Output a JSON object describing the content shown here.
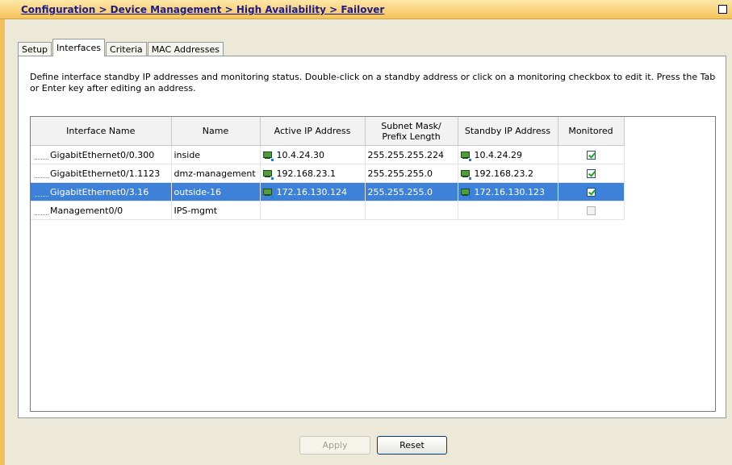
{
  "breadcrumb": {
    "part1": "Configuration > Device Management > High Availability",
    "separator": " > ",
    "part2": "Failover"
  },
  "tabs": [
    {
      "label": "Setup",
      "active": false
    },
    {
      "label": "Interfaces",
      "active": true
    },
    {
      "label": "Criteria",
      "active": false
    },
    {
      "label": "MAC Addresses",
      "active": false
    }
  ],
  "description": "Define interface standby IP addresses and monitoring status. Double-click on a standby address or click on a monitoring checkbox to edit it. Press the Tab or Enter key after editing an address.",
  "table": {
    "headers": {
      "interface_name": "Interface Name",
      "name": "Name",
      "active_ip": "Active IP Address",
      "subnet_line1": "Subnet Mask/",
      "subnet_line2": "Prefix Length",
      "standby_ip": "Standby IP Address",
      "monitored": "Monitored"
    },
    "rows": [
      {
        "interface": "GigabitEthernet0/0.300",
        "name": "inside",
        "active_ip": "10.4.24.30",
        "subnet": "255.255.255.224",
        "standby_ip": "10.4.24.29",
        "monitored": true,
        "selected": false
      },
      {
        "interface": "GigabitEthernet0/1.1123",
        "name": "dmz-management",
        "active_ip": "192.168.23.1",
        "subnet": "255.255.255.0",
        "standby_ip": "192.168.23.2",
        "monitored": true,
        "selected": false
      },
      {
        "interface": "GigabitEthernet0/3.16",
        "name": "outside-16",
        "active_ip": "172.16.130.124",
        "subnet": "255.255.255.0",
        "standby_ip": "172.16.130.123",
        "monitored": true,
        "selected": true
      },
      {
        "interface": "Management0/0",
        "name": "IPS-mgmt",
        "active_ip": "",
        "subnet": "",
        "standby_ip": "",
        "monitored": false,
        "selected": false
      }
    ]
  },
  "buttons": {
    "apply": "Apply",
    "reset": "Reset"
  },
  "icons": {
    "ip": "network-host-icon",
    "restore": "restore-window-icon"
  },
  "colors": {
    "selection": "#3d82d8",
    "title_bar": "#f6c35a",
    "link": "#1a1a8c"
  }
}
